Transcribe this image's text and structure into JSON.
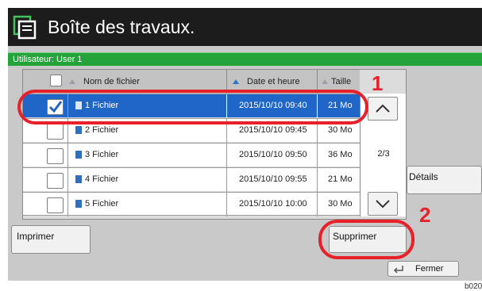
{
  "header": {
    "title": "Boîte des travaux."
  },
  "userbar": {
    "label": "Utilisateur: User 1"
  },
  "table": {
    "columns": {
      "name": "Nom de fichier",
      "date": "Date et heure",
      "size": "Taille"
    },
    "rows": [
      {
        "name": "1 Fichier",
        "date": "2015/10/10 09:40",
        "size": "21 Mo",
        "checked": true
      },
      {
        "name": "2 Fichier",
        "date": "2015/10/10 09:45",
        "size": "30 Mo",
        "checked": false
      },
      {
        "name": "3 Fichier",
        "date": "2015/10/10 09:50",
        "size": "36 Mo",
        "checked": false
      },
      {
        "name": "4 Fichier",
        "date": "2015/10/10 09:55",
        "size": "21 Mo",
        "checked": false
      },
      {
        "name": "5 Fichier",
        "date": "2015/10/10 10:00",
        "size": "30 Mo",
        "checked": false
      }
    ]
  },
  "pager": {
    "label": "2/3"
  },
  "buttons": {
    "details": "Détails",
    "print": "Imprimer",
    "delete": "Supprimer",
    "close": "Fermer"
  },
  "callouts": {
    "one": "1",
    "two": "2"
  },
  "image_code": "b020",
  "colors": {
    "selected_row": "#1f66c8",
    "userbar": "#23a33a",
    "callout": "#e8202a"
  }
}
